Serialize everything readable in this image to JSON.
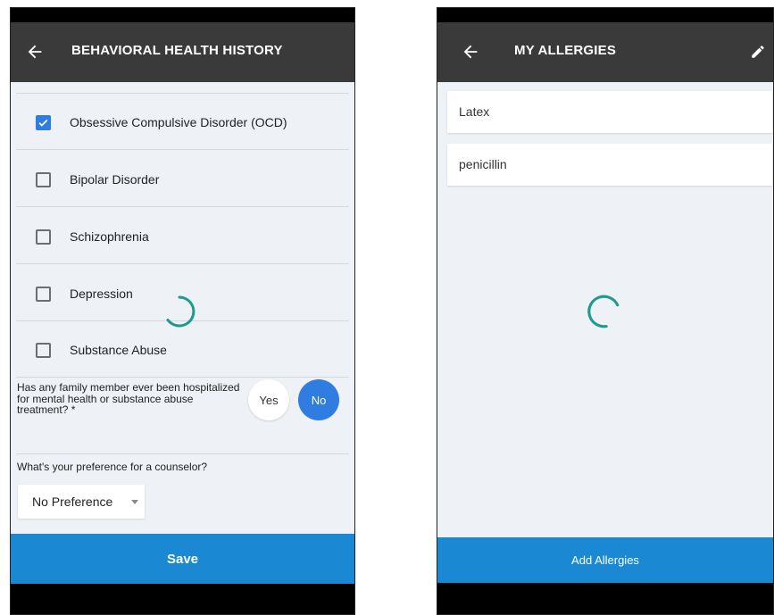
{
  "left_screen": {
    "title": "BEHAVIORAL HEALTH HISTORY",
    "conditions": [
      {
        "label": "Obsessive Compulsive Disorder (OCD)",
        "checked": true
      },
      {
        "label": "Bipolar Disorder",
        "checked": false
      },
      {
        "label": "Schizophrenia",
        "checked": false
      },
      {
        "label": "Depression",
        "checked": false
      },
      {
        "label": "Substance Abuse",
        "checked": false
      }
    ],
    "family_question": "Has any family member ever been hospitalized for mental health or substance abuse treatment? *",
    "yes_label": "Yes",
    "no_label": "No",
    "selected_answer": "No",
    "counselor_question": "What's your preference for a counselor?",
    "counselor_preference": "No Preference",
    "save_label": "Save"
  },
  "right_screen": {
    "title": "MY ALLERGIES",
    "allergies": [
      "Latex",
      "penicillin"
    ],
    "add_label": "Add Allergies"
  },
  "colors": {
    "app_bar": "#3a3a3a",
    "content_bg": "#eef1f6",
    "accent_blue": "#2f7de1",
    "button_blue": "#1a88d2",
    "spinner_teal": "#1e9b8f"
  },
  "icons": {
    "back": "arrow-left-icon",
    "edit": "pencil-icon",
    "loading": "spinner-icon",
    "dropdown": "caret-down-icon"
  }
}
